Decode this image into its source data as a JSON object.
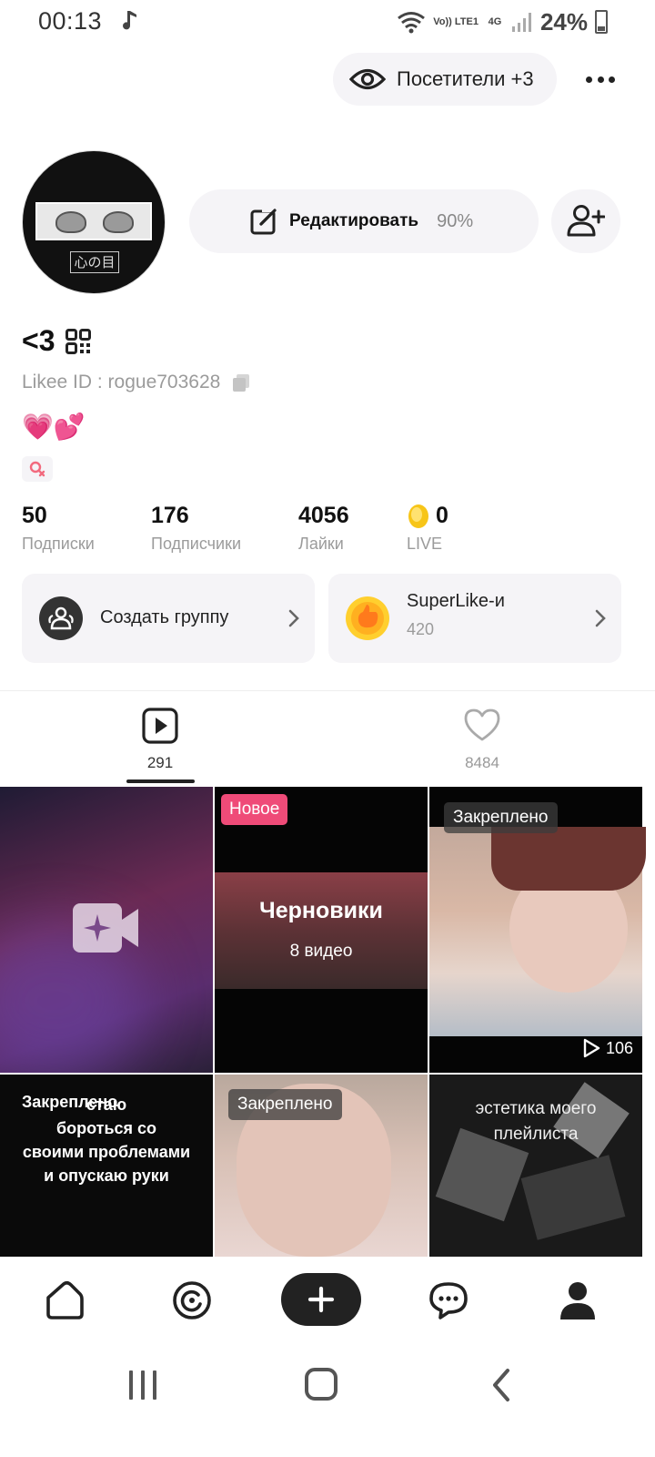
{
  "status_bar": {
    "time": "00:13",
    "volte": "Vo)) LTE1",
    "network": "4G",
    "battery": "24%"
  },
  "header": {
    "visitors_label": "Посетители +3"
  },
  "profile": {
    "avatar_kanji": "心の目",
    "edit_label": "Редактировать",
    "edit_percent": "90%",
    "name": "<3",
    "likee_id": "Likee ID : rogue703628",
    "bio": "💗💕"
  },
  "stats": [
    {
      "value": "50",
      "label": "Подписки"
    },
    {
      "value": "176",
      "label": "Подписчики"
    },
    {
      "value": "4056",
      "label": "Лайки"
    },
    {
      "value": "0",
      "label": "LIVE"
    }
  ],
  "cards": {
    "group_label": "Создать группу",
    "superlike_title": "SuperLike-и",
    "superlike_count": "420"
  },
  "tabs": {
    "videos_count": "291",
    "likes_count": "8484"
  },
  "grid": {
    "new_badge": "Новое",
    "drafts_title": "Черновики",
    "drafts_count": "8 видео",
    "pinned_label": "Закреплено",
    "pinned1_views": "106",
    "text_video_overlay": "стаю\nбороться со\nсвоими проблемами\nи опускаю руки",
    "aesthetic_text": "эстетика моего\nплейлиста"
  },
  "colors": {
    "accent_pink": "#ef4b78",
    "background": "#ffffff",
    "card_bg": "#f5f4f7"
  }
}
